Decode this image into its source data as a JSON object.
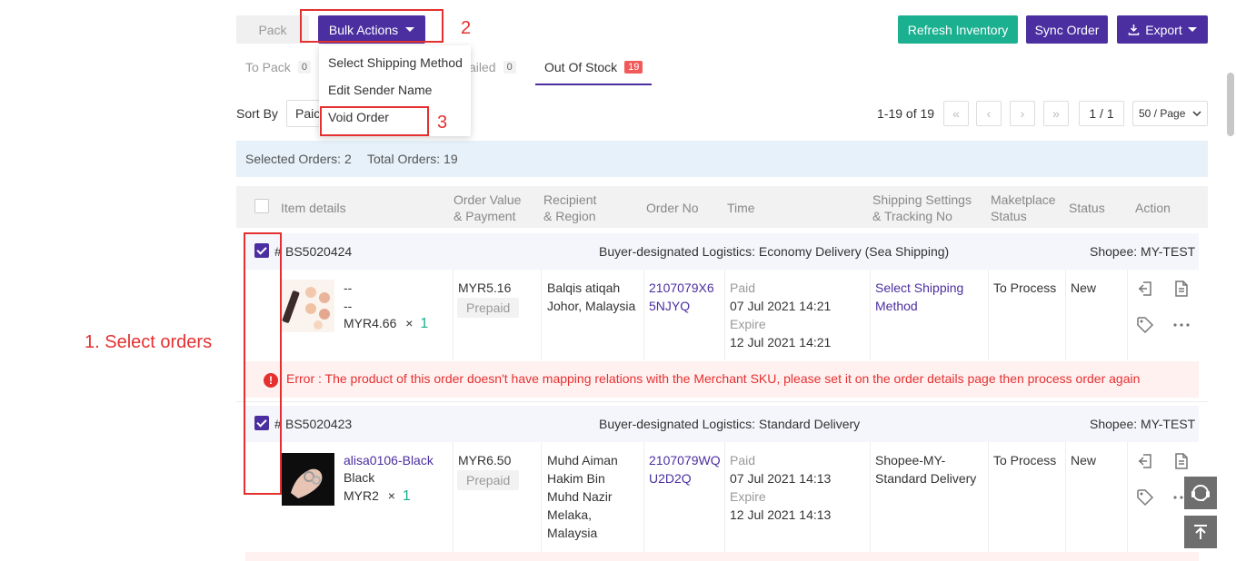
{
  "toolbar": {
    "pack_label": "Pack",
    "bulk_actions_label": "Bulk Actions",
    "refresh_label": "Refresh Inventory",
    "sync_label": "Sync Order",
    "export_label": "Export"
  },
  "bulk_menu": {
    "items": [
      "Select Shipping Method",
      "Edit Sender Name",
      "Void Order"
    ]
  },
  "tabs": [
    {
      "label": "To Pack",
      "count": "0"
    },
    {
      "label": "ailed",
      "count": "0"
    },
    {
      "label": "Out Of Stock",
      "count": "19"
    }
  ],
  "sort": {
    "label": "Sort By",
    "value": "Paic"
  },
  "pagination": {
    "info": "1-19 of 19",
    "first": "«",
    "prev": "‹",
    "next": "›",
    "last": "»",
    "current": "1 / 1",
    "per_page": "50 / Page"
  },
  "summary": {
    "selected": "Selected Orders: 2",
    "total": "Total Orders: 19"
  },
  "table_headers": {
    "item_details": "Item details",
    "order_value_1": "Order Value",
    "order_value_2": "& Payment",
    "recipient_1": "Recipient",
    "recipient_2": "& Region",
    "order_no": "Order No",
    "time": "Time",
    "shipping_1": "Shipping Settings",
    "shipping_2": "& Tracking No",
    "marketplace_1": "Maketplace",
    "marketplace_2": "Status",
    "status": "Status",
    "action": "Action"
  },
  "orders": [
    {
      "hash": "#",
      "id": "BS5020424",
      "logistics": "Buyer-designated Logistics: Economy Delivery (Sea Shipping)",
      "shop": "Shopee: MY-TEST",
      "item_line1": "--",
      "item_line2": "--",
      "item_price": "MYR4.66",
      "times": "×",
      "item_qty": "1",
      "value": "MYR5.16",
      "payment": "Prepaid",
      "recipient_lines": [
        "Balqis atiqah",
        "Johor, Malaysia"
      ],
      "order_no_lines": [
        "2107079X6",
        "5NJYQ"
      ],
      "paid_label": "Paid",
      "paid_time": "07 Jul 2021 14:21",
      "expire_label": "Expire",
      "expire_time": "12 Jul 2021 14:21",
      "shipping_lines": [
        "Select Shipping",
        "Method"
      ],
      "marketplace_status": "To Process",
      "status": "New",
      "error_text": "Error :  The product of this order doesn't have mapping relations with the Merchant SKU, please set it on the order details page then process order again"
    },
    {
      "hash": "#",
      "id": "BS5020423",
      "logistics": "Buyer-designated Logistics: Standard Delivery",
      "shop": "Shopee: MY-TEST",
      "item_name": "alisa0106-Black",
      "item_variant": "Black",
      "item_price": "MYR2",
      "times": "×",
      "item_qty": "1",
      "value": "MYR6.50",
      "payment": "Prepaid",
      "recipient_lines": [
        "Muhd Aiman",
        "Hakim Bin",
        "Muhd Nazir",
        "Melaka,",
        "Malaysia"
      ],
      "order_no_lines": [
        "2107079WQ",
        "U2D2Q"
      ],
      "paid_label": "Paid",
      "paid_time": "07 Jul 2021 14:13",
      "expire_label": "Expire",
      "expire_time": "12 Jul 2021 14:13",
      "shipping_lines": [
        "Shopee-MY-",
        "Standard Delivery"
      ],
      "marketplace_status": "To Process",
      "status": "New"
    }
  ],
  "annotations": {
    "step1": "1. Select orders",
    "step2": "2",
    "step3": "3"
  },
  "colors": {
    "primary": "#4b2fa0",
    "teal": "#1bb08f",
    "error": "#e53030",
    "annotation": "#e53030"
  }
}
